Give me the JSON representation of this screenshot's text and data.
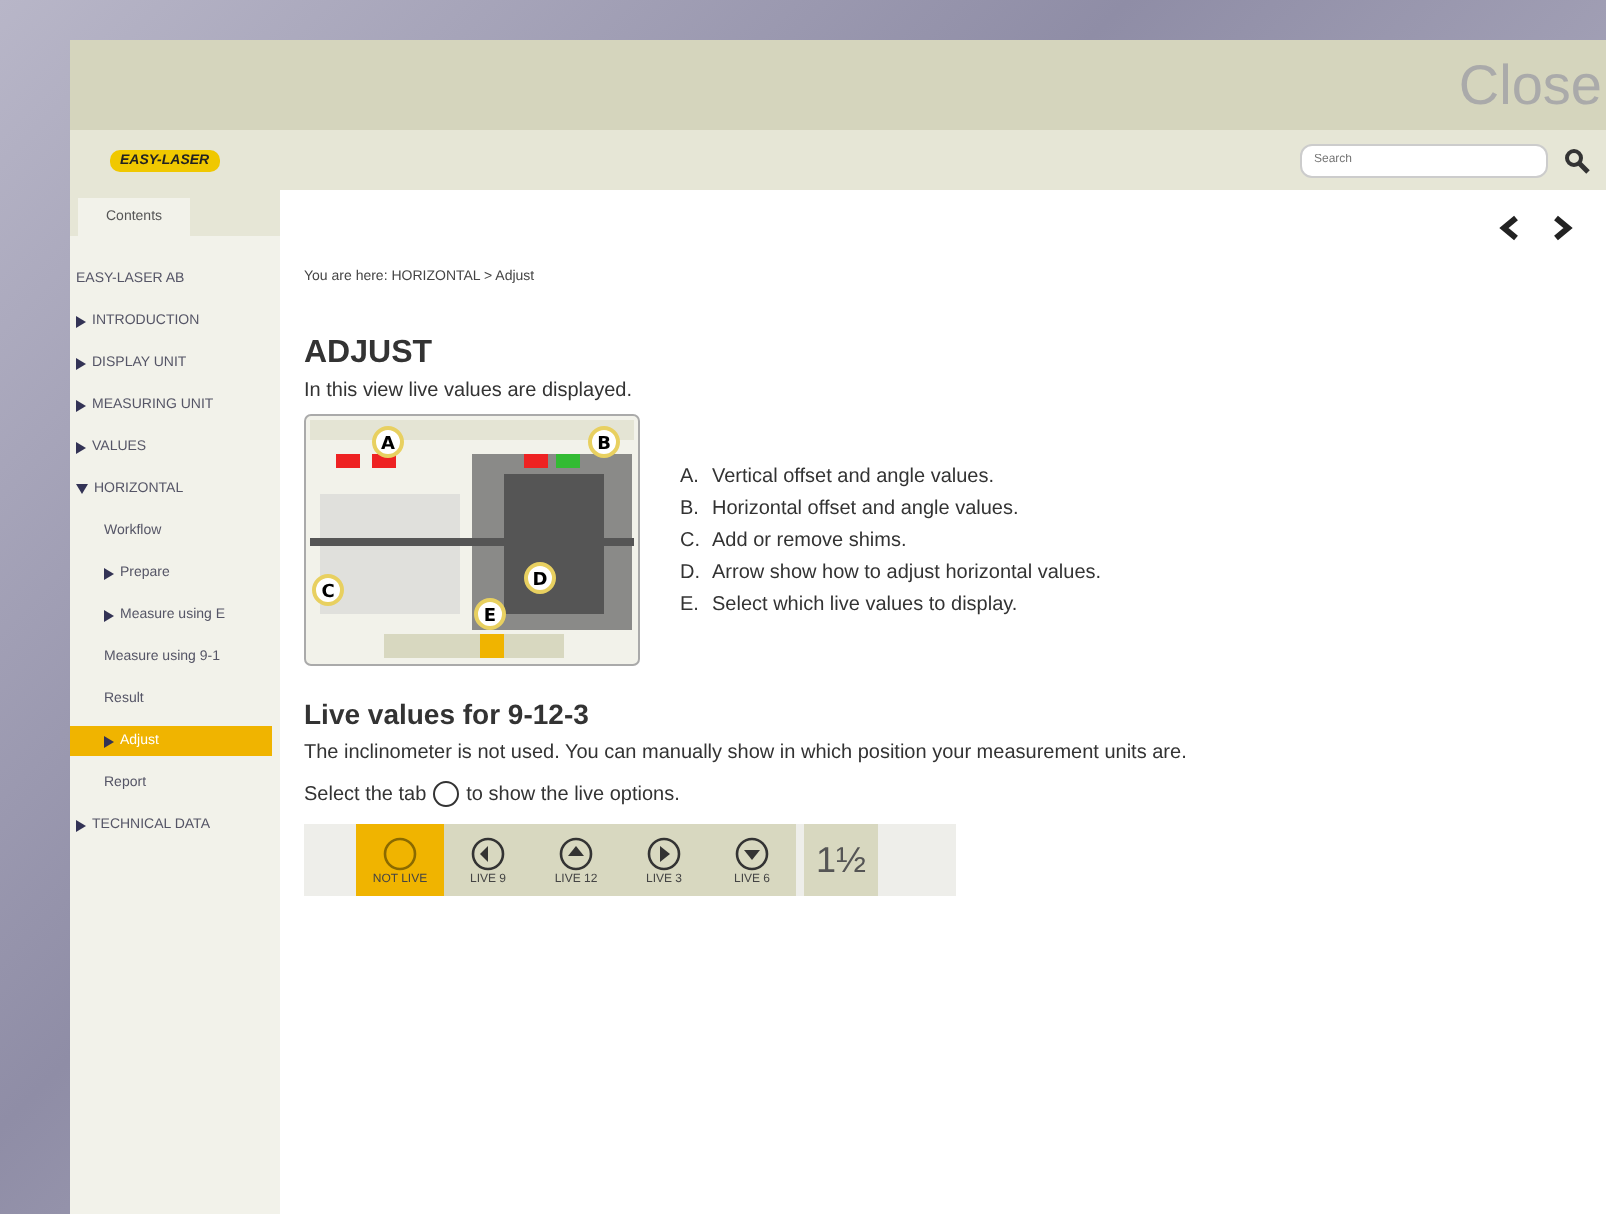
{
  "window": {
    "close": "Close"
  },
  "toolbar": {
    "logo": "EASY-LASER",
    "search": {
      "placeholder": "Search"
    }
  },
  "sidebar": {
    "tab": {
      "label": "Contents",
      "selected": true
    },
    "items": [
      {
        "label": "EASY-LASER AB",
        "kind": "leaf",
        "selected": false
      },
      {
        "label": "INTRODUCTION",
        "kind": "folder",
        "expanded": false,
        "selected": false
      },
      {
        "label": "DISPLAY UNIT",
        "kind": "folder",
        "expanded": false,
        "selected": false
      },
      {
        "label": "MEASURING UNIT",
        "kind": "folder",
        "expanded": false,
        "selected": false
      },
      {
        "label": "VALUES",
        "kind": "folder",
        "expanded": false,
        "selected": false
      },
      {
        "label": "HORIZONTAL",
        "kind": "folder",
        "expanded": true,
        "selected": false,
        "children": [
          {
            "label": "Workflow",
            "kind": "leaf",
            "selected": false
          },
          {
            "label": "Prepare",
            "kind": "folder",
            "expanded": false,
            "selected": false
          },
          {
            "label": "Measure using E",
            "kind": "folder",
            "expanded": false,
            "selected": false
          },
          {
            "label": "Measure using 9-1",
            "kind": "leaf",
            "selected": false
          },
          {
            "label": "Result",
            "kind": "leaf",
            "selected": false
          },
          {
            "label": "Adjust",
            "kind": "folder",
            "expanded": false,
            "selected": true
          },
          {
            "label": "Report",
            "kind": "leaf",
            "selected": false
          }
        ]
      },
      {
        "label": "TECHNICAL DATA",
        "kind": "folder",
        "expanded": false,
        "selected": false
      }
    ]
  },
  "content": {
    "breadcrumb": "You are here: HORIZONTAL > Adjust",
    "title": "ADJUST",
    "intro": "In this view live values are displayed.",
    "figure": {
      "callouts": [
        "A",
        "B",
        "C",
        "D",
        "E"
      ]
    },
    "legend": [
      {
        "letter": "A.",
        "text": "Vertical offset and angle values."
      },
      {
        "letter": "B.",
        "text": "Horizontal offset and angle values."
      },
      {
        "letter": "C.",
        "text": "Add or remove shims."
      },
      {
        "letter": "D.",
        "text": "Arrow show how to adjust horizontal values."
      },
      {
        "letter": "E.",
        "text": "Select which live values to display."
      }
    ],
    "subtitle": "Live values for 9-12-3",
    "paragraph": "The inclinometer is not used. You can manually show in which position your measurement units are.",
    "select_before": "Select the tab",
    "select_after": "to show the live options.",
    "live_tabs": [
      {
        "label": "NOT LIVE",
        "kind": "none",
        "selected": true
      },
      {
        "label": "LIVE 9",
        "kind": "left",
        "selected": false
      },
      {
        "label": "LIVE 12",
        "kind": "up",
        "selected": false
      },
      {
        "label": "LIVE 3",
        "kind": "right",
        "selected": false
      },
      {
        "label": "LIVE 6",
        "kind": "down",
        "selected": false
      }
    ],
    "unit_button": "1½"
  }
}
